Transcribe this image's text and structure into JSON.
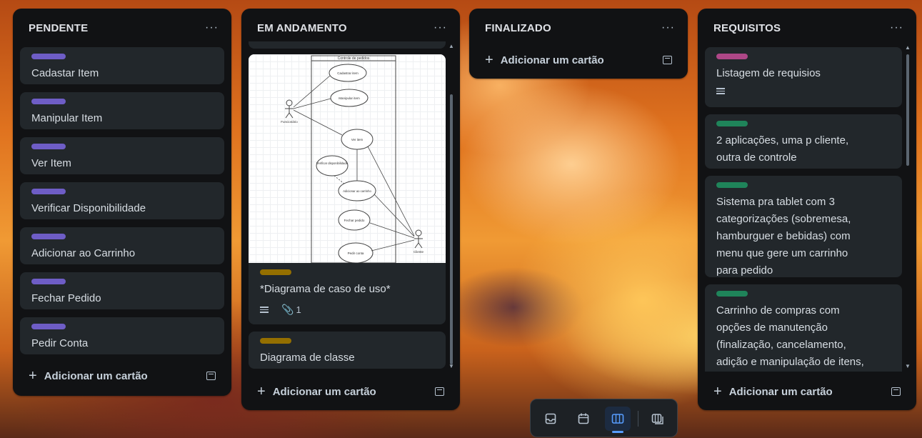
{
  "lists": [
    {
      "title": "PENDENTE",
      "menu": "···",
      "cards": [
        {
          "title": "Cadastar Item",
          "label_color": "#6e5dc6"
        },
        {
          "title": "Manipular Item",
          "label_color": "#6e5dc6"
        },
        {
          "title": "Ver Item",
          "label_color": "#6e5dc6"
        },
        {
          "title": "Verificar Disponibilidade",
          "label_color": "#6e5dc6"
        },
        {
          "title": "Adicionar ao Carrinho",
          "label_color": "#6e5dc6"
        },
        {
          "title": "Fechar Pedido",
          "label_color": "#6e5dc6"
        },
        {
          "title": "Pedir Conta",
          "label_color": "#6e5dc6"
        }
      ],
      "add_label": "Adicionar um cartão"
    },
    {
      "title": "EM ANDAMENTO",
      "menu": "···",
      "cards": [
        {
          "title": "*Diagrama de caso de uso*",
          "label_color": "#946f00",
          "attachments": "1",
          "diagram": {
            "title": "Controle de pedidos",
            "actor_left": "Funcionário",
            "actor_right": "Cliente",
            "use_cases": [
              "Cadastrar item",
              "Manipular item",
              "Ver item",
              "Verificar disponibilidade",
              "Adicionar ao carrinho",
              "Fechar pedido",
              "Pedir conta"
            ]
          }
        },
        {
          "title": "Diagrama de classe",
          "label_color": "#946f00"
        }
      ],
      "add_label": "Adicionar um cartão"
    },
    {
      "title": "FINALIZADO",
      "menu": "···",
      "cards": [],
      "add_label": "Adicionar um cartão"
    },
    {
      "title": "REQUISITOS",
      "menu": "···",
      "cards": [
        {
          "title": "Listagem de requisios",
          "label_color": "#ae4787"
        },
        {
          "title": "2 aplicações, uma p cliente, outra de controle",
          "label_color": "#1f845a"
        },
        {
          "title": "Sistema pra tablet com 3 categorizações (sobremesa, hamburguer e bebidas) com menu que gere um carrinho para pedido",
          "label_color": "#1f845a"
        },
        {
          "title": "Carrinho de compras com opções de manutenção (finalização, cancelamento, adição e manipulação de itens, etc)",
          "label_color": "#1f845a"
        }
      ],
      "add_label": "Adicionar um cartão"
    }
  ],
  "toolbar": {
    "items": [
      "inbox-icon",
      "calendar-icon",
      "board-icon",
      "switch-boards-icon"
    ],
    "active": "board-icon"
  }
}
